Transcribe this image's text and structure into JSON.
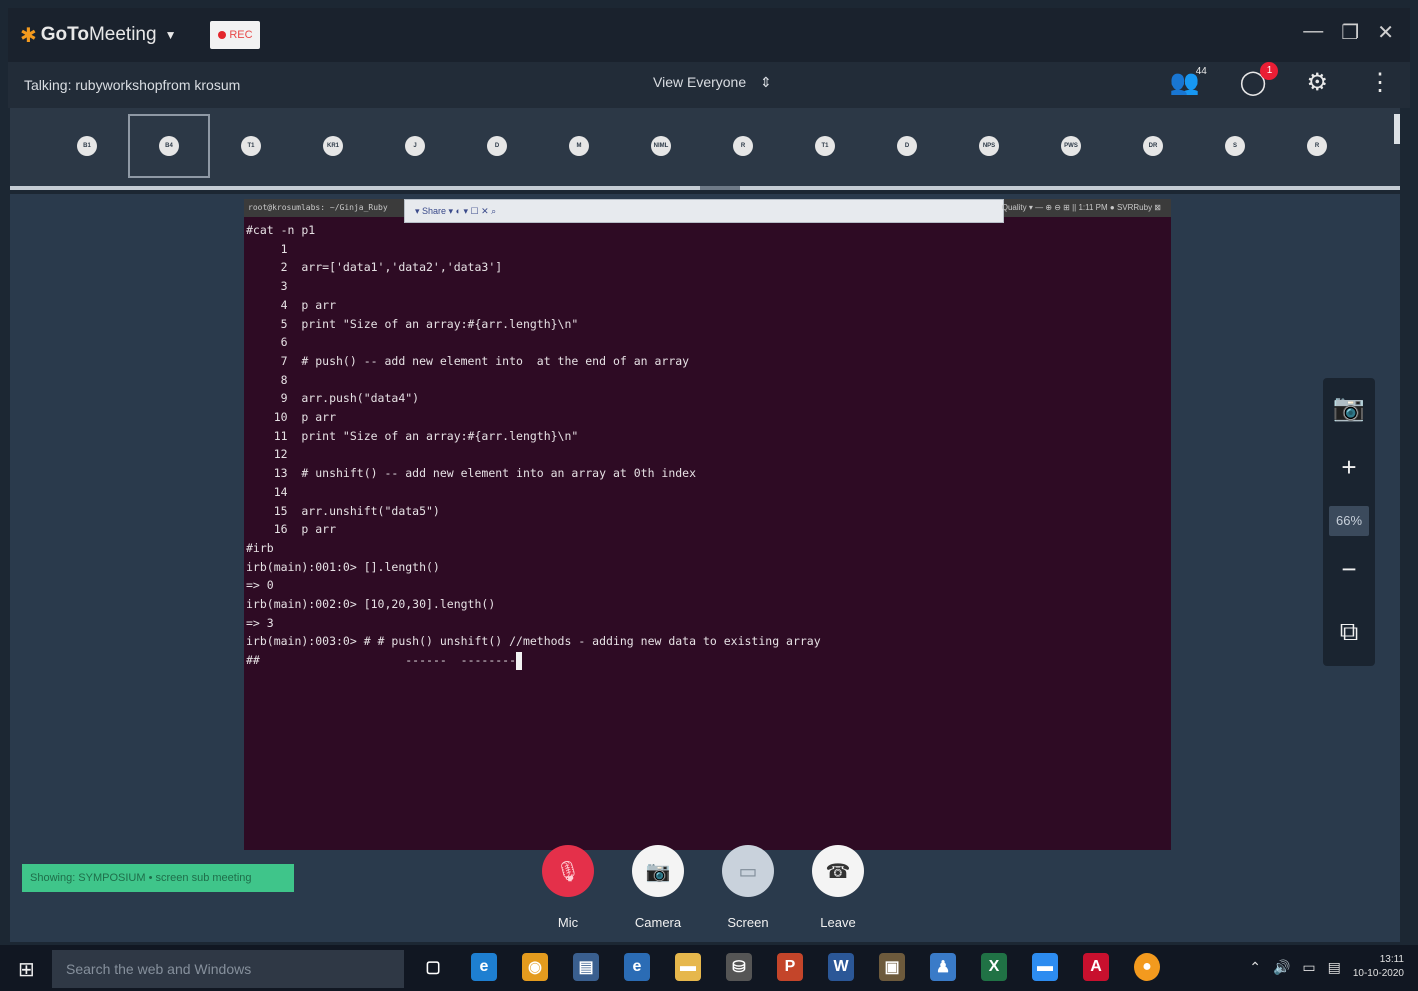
{
  "app": {
    "logo_goto": "GoTo",
    "logo_meeting": "Meeting",
    "rec_label": "REC",
    "window_controls": [
      "—",
      "❐",
      "✕"
    ]
  },
  "talkbar": {
    "talking": "Talking: rubyworkshopfrom krosum",
    "view_label": "View Everyone",
    "attendee_count": "44",
    "chat_badge": "1"
  },
  "attendees": [
    "B1",
    "B4",
    "T1",
    "KR1",
    "J",
    "D",
    "M",
    "NIML",
    "R",
    "T1",
    "D",
    "NPS",
    "PWS",
    "DR",
    "S",
    "R"
  ],
  "terminal": {
    "title": "root@krosumlabs: ~/Ginja_Ruby",
    "toolbar_text": "▾  Share ▾     ◐ ▾  ☐  ✕  ⌕",
    "right_text": "Quality ▾    —  ⊕  ⊖  ⊞    ||  1:11 PM  ●  SVRRuby  ⊠",
    "lines": [
      "#cat -n p1",
      "     1",
      "     2  arr=['data1','data2','data3']",
      "     3",
      "     4  p arr",
      "     5  print \"Size of an array:#{arr.length}\\n\"",
      "     6",
      "     7  # push() -- add new element into  at the end of an array",
      "     8",
      "     9  arr.push(\"data4\")",
      "    10  p arr",
      "    11  print \"Size of an array:#{arr.length}\\n\"",
      "    12",
      "    13  # unshift() -- add new element into an array at 0th index",
      "    14",
      "    15  arr.unshift(\"data5\")",
      "    16  p arr",
      "#irb",
      "irb(main):001:0> [].length()",
      "=> 0",
      "irb(main):002:0> [10,20,30].length()",
      "=> 3",
      "irb(main):003:0> # # push() unshift() //methods - adding new data to existing array",
      "##"
    ],
    "cursor_line": "                     ------  --------"
  },
  "zoom": {
    "percent": "66%"
  },
  "status_pill": "Showing: SYMPOSIUM • screen sub meeting",
  "controls": {
    "mic": "Mic",
    "camera": "Camera",
    "screen": "Screen",
    "leave": "Leave"
  },
  "taskbar": {
    "search_placeholder": "Search the web and Windows",
    "time": "13:11",
    "date": "10-10-2020"
  },
  "colors": {
    "mic_red": "#e4304a",
    "status_green": "#3fc58a",
    "terminal_bg": "#2e0b24"
  }
}
